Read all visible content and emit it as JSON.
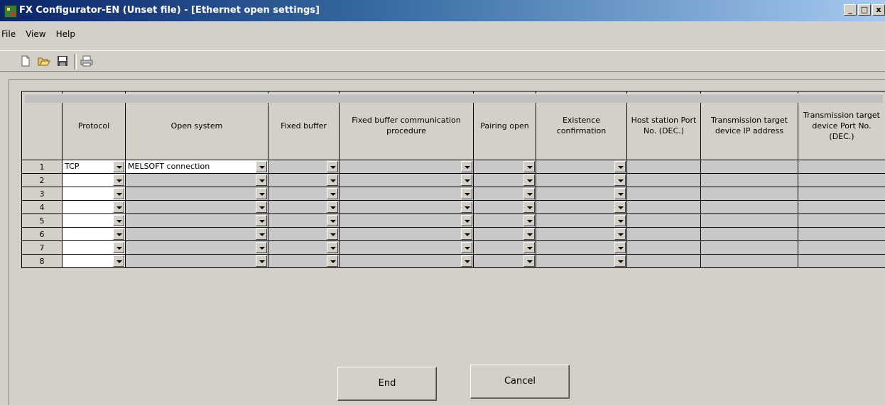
{
  "window": {
    "title": "FX Configurator-EN (Unset file) - [Ethernet open settings]",
    "controls": [
      "_",
      "□",
      "x"
    ]
  },
  "menu": [
    "File",
    "View",
    "Help"
  ],
  "toolbar": {
    "buttons": [
      "new-file-icon",
      "open-folder-icon",
      "save-icon",
      "print-icon"
    ]
  },
  "table": {
    "corner": "",
    "headers": [
      "Protocol",
      "Open system",
      "Fixed buffer",
      "Fixed buffer communication procedure",
      "Pairing open",
      "Existence confirmation",
      "Host station Port No. (DEC.)",
      "Transmission target device IP address",
      "Transmission target device Port No. (DEC.)"
    ],
    "rows": [
      {
        "num": "1",
        "protocol": "TCP",
        "open_system": "MELSOFT connection"
      },
      {
        "num": "2",
        "protocol": "",
        "open_system": ""
      },
      {
        "num": "3",
        "protocol": "",
        "open_system": ""
      },
      {
        "num": "4",
        "protocol": "",
        "open_system": ""
      },
      {
        "num": "5",
        "protocol": "",
        "open_system": ""
      },
      {
        "num": "6",
        "protocol": "",
        "open_system": ""
      },
      {
        "num": "7",
        "protocol": "",
        "open_system": ""
      },
      {
        "num": "8",
        "protocol": "",
        "open_system": ""
      }
    ]
  },
  "buttons": {
    "end": "End",
    "cancel": "Cancel"
  }
}
